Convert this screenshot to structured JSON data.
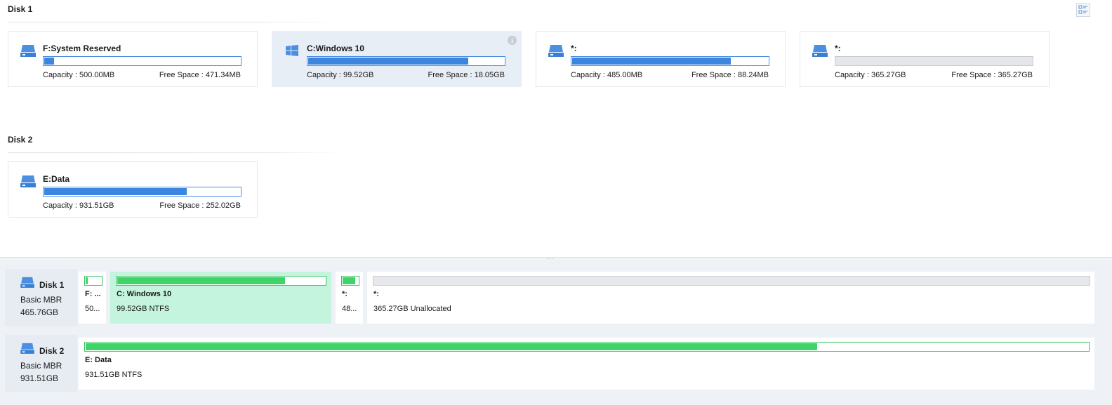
{
  "upper": {
    "disks": [
      {
        "heading": "Disk 1",
        "partitions": [
          {
            "name": "F:System Reserved",
            "capacity": "Capacity : 500.00MB",
            "free": "Free Space : 471.34MB",
            "used_fraction": 0.058,
            "icon": "drive-icon"
          },
          {
            "name": "C:Windows 10",
            "capacity": "Capacity : 99.52GB",
            "free": "Free Space : 18.05GB",
            "used_fraction": 0.82,
            "icon": "windows-icon",
            "selected": true
          },
          {
            "name": "*:",
            "capacity": "Capacity : 485.00MB",
            "free": "Free Space : 88.24MB",
            "used_fraction": 0.81,
            "icon": "drive-icon"
          },
          {
            "name": "*:",
            "capacity": "Capacity : 365.27GB",
            "free": "Free Space : 365.27GB",
            "used_fraction": 0,
            "icon": "drive-icon",
            "unallocated": true
          }
        ]
      },
      {
        "heading": "Disk 2",
        "partitions": [
          {
            "name": "E:Data",
            "capacity": "Capacity : 931.51GB",
            "free": "Free Space : 252.02GB",
            "used_fraction": 0.73,
            "icon": "drive-icon"
          }
        ]
      }
    ]
  },
  "map": {
    "disks": [
      {
        "name": "Disk 1",
        "type": "Basic MBR",
        "size": "465.76GB",
        "segments": [
          {
            "name": "F: ...",
            "info": "50...",
            "used_fraction": 0.2
          },
          {
            "name": "C: Windows 10",
            "info": "99.52GB NTFS",
            "used_fraction": 0.81,
            "selected": true
          },
          {
            "name": "*:",
            "info": "48...",
            "used_fraction": 0.82
          },
          {
            "name": "*:",
            "info": "365.27GB Unallocated",
            "used_fraction": 0,
            "unallocated": true
          }
        ]
      },
      {
        "name": "Disk 2",
        "type": "Basic MBR",
        "size": "931.51GB",
        "segments": [
          {
            "name": "E: Data",
            "info": "931.51GB NTFS",
            "used_fraction": 0.73
          }
        ]
      }
    ]
  },
  "colors": {
    "bar_blue": "#3d86e0",
    "bar_green": "#3ed467",
    "selected_card": "#e8eef6",
    "selected_segment": "#c4f4dd"
  }
}
